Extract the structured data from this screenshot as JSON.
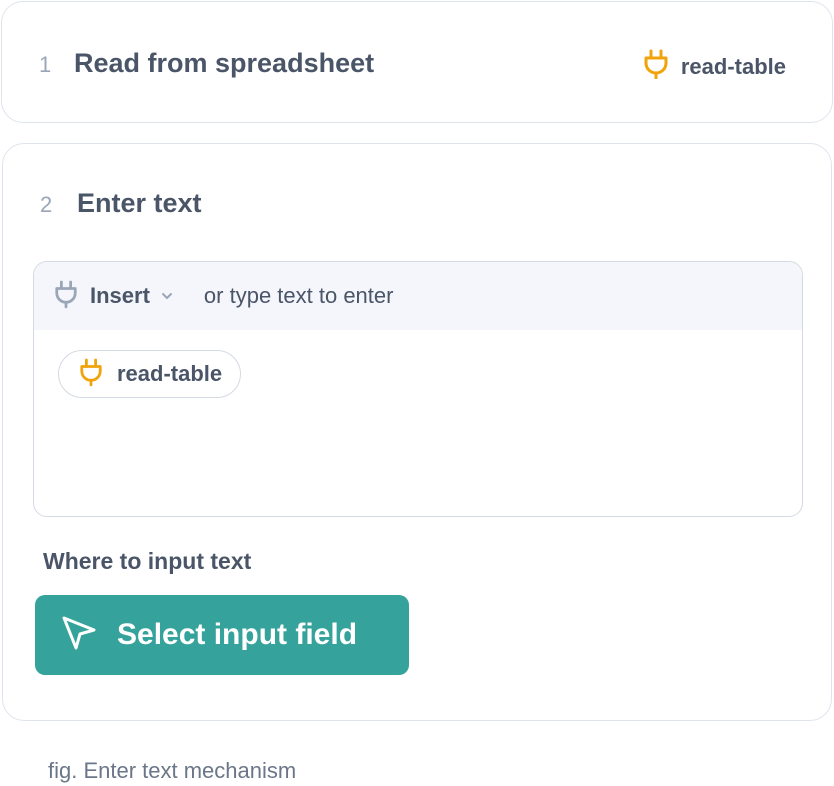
{
  "steps": [
    {
      "number": "1",
      "title": "Read from spreadsheet",
      "plugin_icon": "plug-icon",
      "plugin_label": "read-table"
    },
    {
      "number": "2",
      "title": "Enter text",
      "editor": {
        "insert_label": "Insert",
        "insert_icon": "plug-icon",
        "hint": "or type text to enter",
        "chip_icon": "plug-icon",
        "chip_label": "read-table"
      },
      "where_label": "Where to input text",
      "select_button": {
        "icon": "cursor-pointer-icon",
        "label": "Select input field"
      }
    }
  ],
  "caption": "fig. Enter text mechanism",
  "colors": {
    "accent_teal": "#35a39c",
    "plug_orange": "#f0a30a",
    "plug_gray": "#9aa6b8",
    "text_dark": "#4a5568",
    "border": "#dfe4ec"
  }
}
